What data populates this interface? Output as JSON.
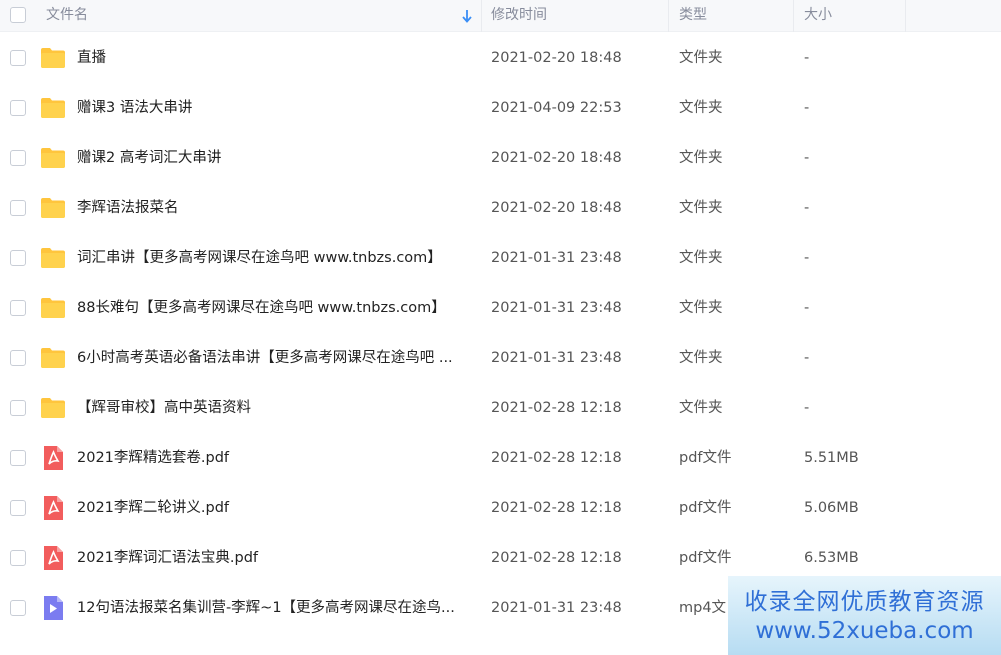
{
  "header": {
    "name": "文件名",
    "modified": "修改时间",
    "type": "类型",
    "size": "大小",
    "sort_icon": "arrow-down-icon"
  },
  "rows": [
    {
      "name": "直播",
      "date": "2021-02-20 18:48",
      "type": "文件夹",
      "size": "-",
      "icon": "folder-icon"
    },
    {
      "name": "赠课3 语法大串讲",
      "date": "2021-04-09 22:53",
      "type": "文件夹",
      "size": "-",
      "icon": "folder-icon"
    },
    {
      "name": "赠课2  高考词汇大串讲",
      "date": "2021-02-20 18:48",
      "type": "文件夹",
      "size": "-",
      "icon": "folder-icon"
    },
    {
      "name": "李辉语法报菜名",
      "date": "2021-02-20 18:48",
      "type": "文件夹",
      "size": "-",
      "icon": "folder-icon"
    },
    {
      "name": "词汇串讲【更多高考网课尽在途鸟吧 www.tnbzs.com】",
      "date": "2021-01-31 23:48",
      "type": "文件夹",
      "size": "-",
      "icon": "folder-icon"
    },
    {
      "name": "88长难句【更多高考网课尽在途鸟吧 www.tnbzs.com】",
      "date": "2021-01-31 23:48",
      "type": "文件夹",
      "size": "-",
      "icon": "folder-icon"
    },
    {
      "name": "6小时高考英语必备语法串讲【更多高考网课尽在途鸟吧 ...",
      "date": "2021-01-31 23:48",
      "type": "文件夹",
      "size": "-",
      "icon": "folder-icon"
    },
    {
      "name": "【辉哥审校】高中英语资料",
      "date": "2021-02-28 12:18",
      "type": "文件夹",
      "size": "-",
      "icon": "folder-icon"
    },
    {
      "name": "2021李辉精选套卷.pdf",
      "date": "2021-02-28 12:18",
      "type": "pdf文件",
      "size": "5.51MB",
      "icon": "pdf-icon"
    },
    {
      "name": "2021李辉二轮讲义.pdf",
      "date": "2021-02-28 12:18",
      "type": "pdf文件",
      "size": "5.06MB",
      "icon": "pdf-icon"
    },
    {
      "name": "2021李辉词汇语法宝典.pdf",
      "date": "2021-02-28 12:18",
      "type": "pdf文件",
      "size": "6.53MB",
      "icon": "pdf-icon"
    },
    {
      "name": "12句语法报菜名集训营-李辉~1【更多高考网课尽在途鸟...",
      "date": "2021-01-31 23:48",
      "type": "mp4文",
      "size": "",
      "icon": "video-icon"
    }
  ],
  "watermark": {
    "line1": "收录全网优质教育资源",
    "line2": "www.52xueba.com"
  },
  "colors": {
    "folder": "#ffc53d",
    "pdf": "#f25d5d",
    "video": "#7b7cf0",
    "watermark_text": "#2f6fd6"
  }
}
